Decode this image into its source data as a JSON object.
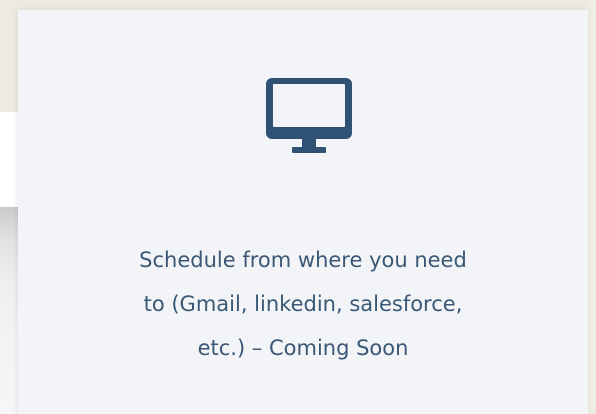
{
  "feature_card": {
    "icon": "desktop-monitor-icon",
    "description_lines": [
      "Schedule from where you need",
      "to (Gmail, linkedin, salesforce,",
      "etc.) – Coming Soon"
    ]
  },
  "colors": {
    "card_background": "#f2f4f7",
    "icon_color": "#2f5274",
    "text_color": "#3a5875",
    "page_background": "#edeae0"
  }
}
